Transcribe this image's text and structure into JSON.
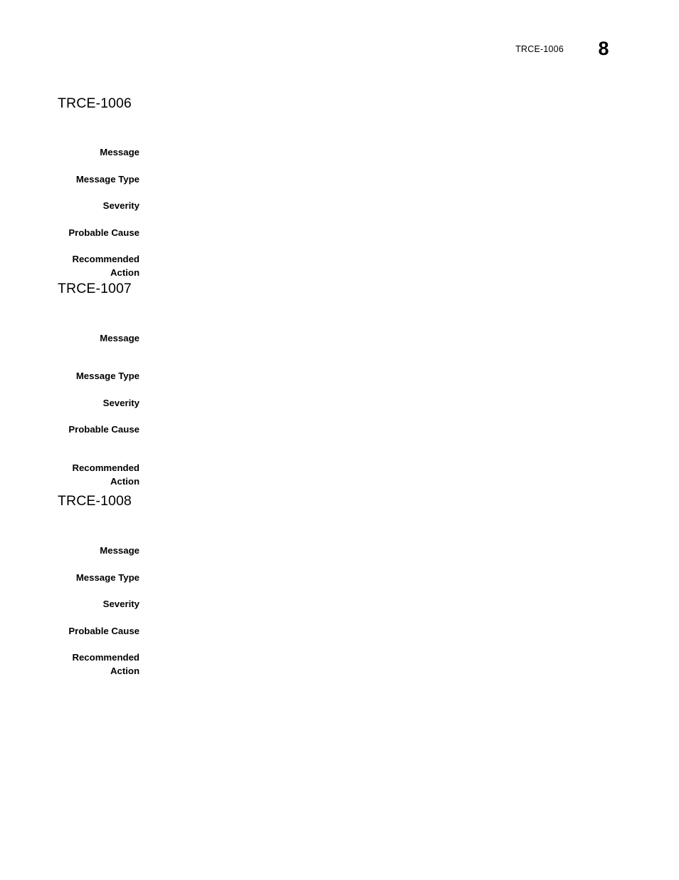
{
  "document": {
    "page_number": "8",
    "running_header": "TRCE-1006",
    "background_color": "#ffffff",
    "text_color": "#000000"
  },
  "field_labels": {
    "message": "Message",
    "message_type": "Message Type",
    "severity": "Severity",
    "probable_cause": "Probable Cause",
    "recommended_action_line1": "Recommended",
    "recommended_action_line2": "Action"
  },
  "sections": [
    {
      "id": "trce-1006",
      "heading": "TRCE-1006",
      "fields": [
        {
          "label": "Message",
          "value": ""
        },
        {
          "label": "Message Type",
          "value": ""
        },
        {
          "label": "Severity",
          "value": ""
        },
        {
          "label": "Probable Cause",
          "value": ""
        },
        {
          "label": "Recommended Action",
          "value": ""
        }
      ]
    },
    {
      "id": "trce-1007",
      "heading": "TRCE-1007",
      "fields": [
        {
          "label": "Message",
          "value": ""
        },
        {
          "label": "Message Type",
          "value": ""
        },
        {
          "label": "Severity",
          "value": ""
        },
        {
          "label": "Probable Cause",
          "value": ""
        },
        {
          "label": "Recommended Action",
          "value": ""
        }
      ]
    },
    {
      "id": "trce-1008",
      "heading": "TRCE-1008",
      "fields": [
        {
          "label": "Message",
          "value": ""
        },
        {
          "label": "Message Type",
          "value": ""
        },
        {
          "label": "Severity",
          "value": ""
        },
        {
          "label": "Probable Cause",
          "value": ""
        },
        {
          "label": "Recommended Action",
          "value": ""
        }
      ]
    }
  ]
}
